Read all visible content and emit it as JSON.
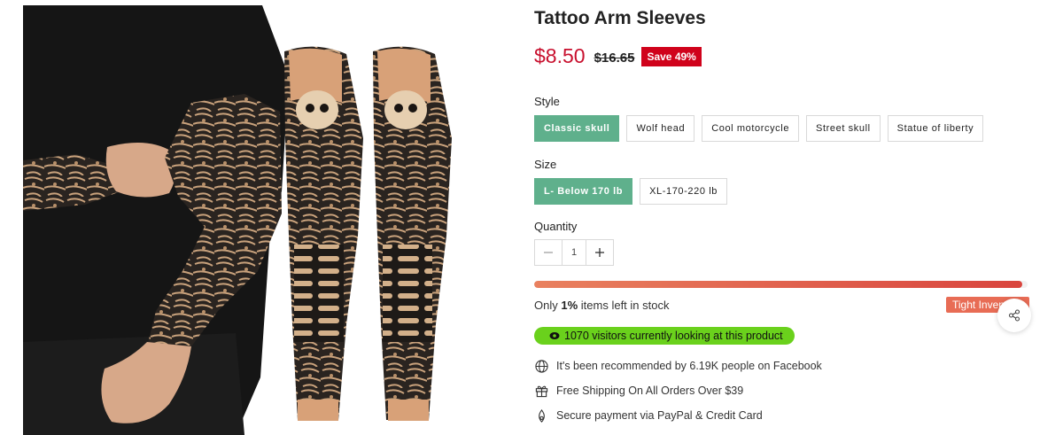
{
  "product": {
    "title": "Tattoo Arm Sleeves",
    "price_current": "$8.50",
    "price_old": "$16.65",
    "save_badge": "Save 49%"
  },
  "style": {
    "label": "Style",
    "options": [
      "Classic skull",
      "Wolf head",
      "Cool motorcycle",
      "Street skull",
      "Statue of liberty"
    ],
    "selected": "Classic skull"
  },
  "size": {
    "label": "Size",
    "options": [
      "L- Below 170 lb",
      "XL-170-220 lb"
    ],
    "selected": "L- Below 170 lb"
  },
  "quantity": {
    "label": "Quantity",
    "value": "1"
  },
  "stock": {
    "prefix": "Only",
    "percent": "1%",
    "suffix": "items left in stock",
    "fill_fraction": 0.99,
    "tag": "Tight Inventory"
  },
  "visitors": {
    "text": "1070 visitors currently looking at this product"
  },
  "features": [
    {
      "icon": "globe-icon",
      "text": "It's been recommended by 6.19K people on Facebook"
    },
    {
      "icon": "gift-icon",
      "text": "Free Shipping On All Orders Over $39"
    },
    {
      "icon": "secure-payment-icon",
      "text": "Secure payment via PayPal & Credit Card"
    }
  ],
  "colors": {
    "price": "#c8102e",
    "save_badge": "#d0021b",
    "selected_option": "#5fb08c",
    "visitors_badge": "#6ad11c",
    "inventory_tag": "#e86c55"
  }
}
